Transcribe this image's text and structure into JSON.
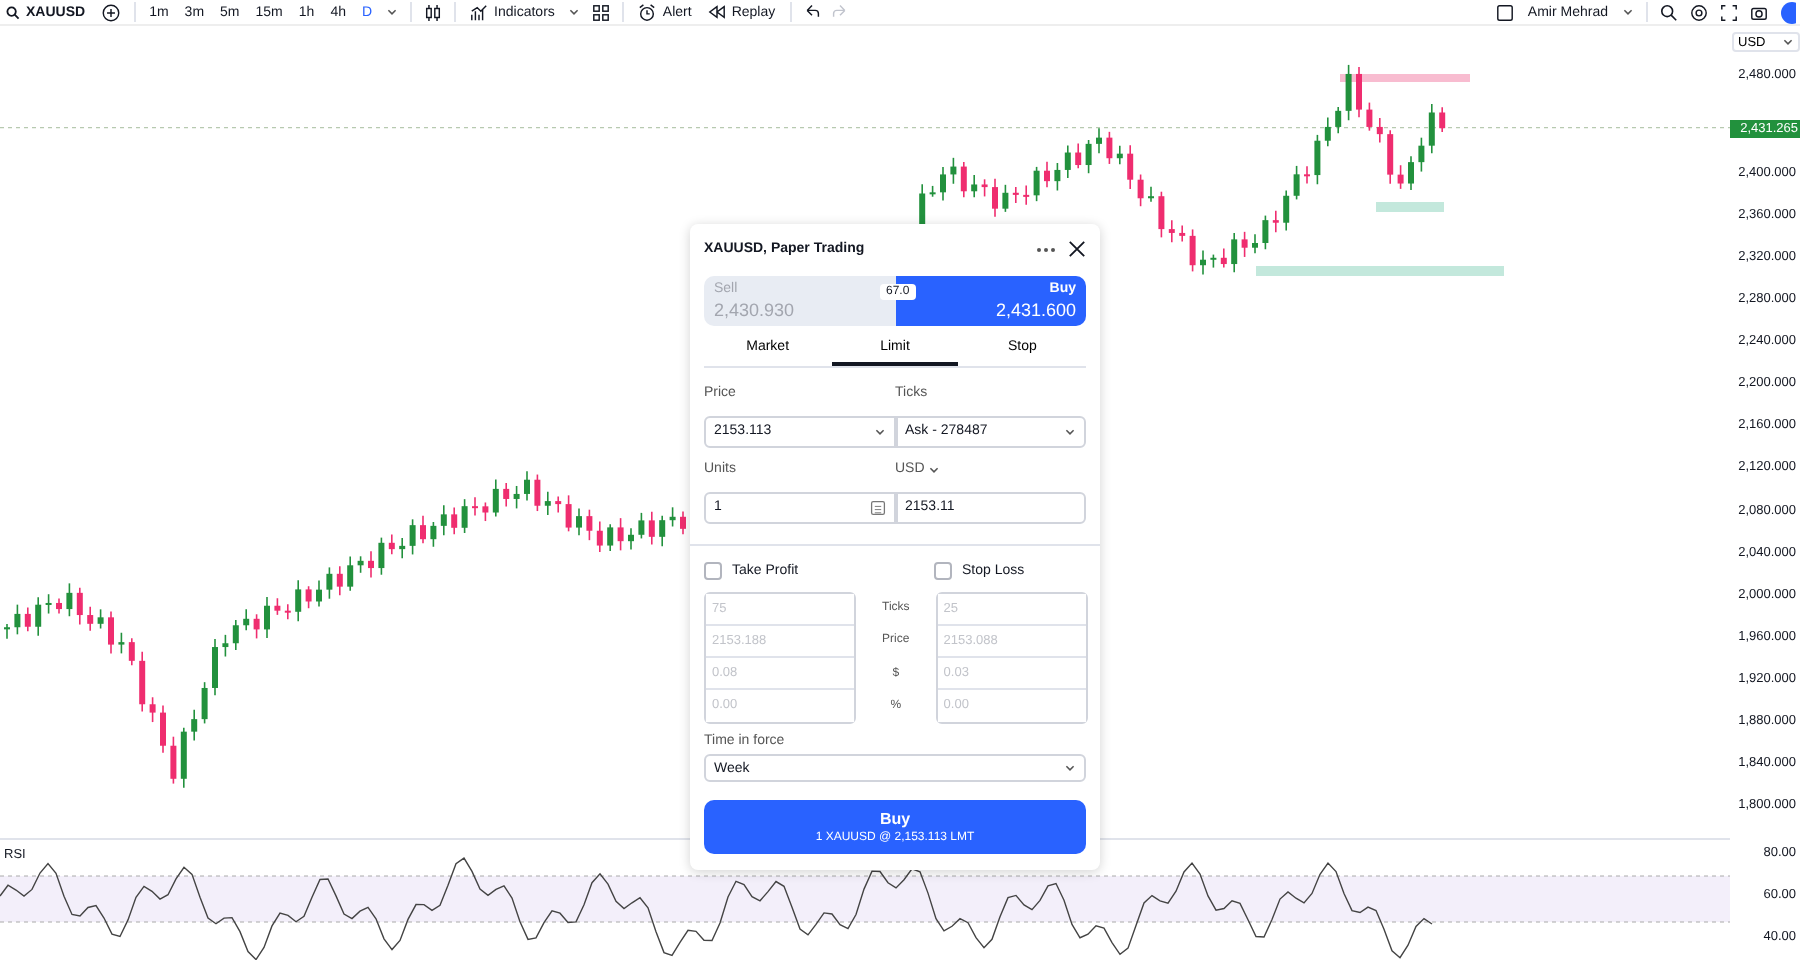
{
  "toolbar": {
    "symbol": "XAUUSD",
    "intervals": [
      {
        "label": "1m",
        "selected": false
      },
      {
        "label": "3m",
        "selected": false
      },
      {
        "label": "5m",
        "selected": false
      },
      {
        "label": "15m",
        "selected": false
      },
      {
        "label": "1h",
        "selected": false
      },
      {
        "label": "4h",
        "selected": false
      },
      {
        "label": "D",
        "selected": true
      }
    ],
    "indicators": "Indicators",
    "alert": "Alert",
    "replay": "Replay",
    "user": "Amir Mehrad"
  },
  "chart": {
    "currency": "USD",
    "price_ticks": [
      "2,480.000",
      "2,400.000",
      "2,360.000",
      "2,320.000",
      "2,280.000",
      "2,240.000",
      "2,200.000",
      "2,160.000",
      "2,120.000",
      "2,080.000",
      "2,040.000",
      "2,000.000",
      "1,960.000",
      "1,920.000",
      "1,880.000",
      "1,840.000",
      "1,800.000"
    ],
    "last_price": "2,431.265"
  },
  "rsi": {
    "label": "RSI",
    "ticks": [
      "80.00",
      "60.00",
      "40.00"
    ]
  },
  "order_panel": {
    "title": "XAUUSD, Paper Trading",
    "sides": [
      {
        "label": "Sell",
        "price": "2,430.930",
        "selected": false
      },
      {
        "label": "Buy",
        "price": "2,431.600",
        "selected": true
      }
    ],
    "spread": "67.0",
    "order_types": [
      {
        "label": "Market",
        "selected": false
      },
      {
        "label": "Limit",
        "selected": true
      },
      {
        "label": "Stop",
        "selected": false
      }
    ],
    "price": {
      "label": "Price",
      "value": "2153.113"
    },
    "ticks": {
      "label": "Ticks",
      "value": "Ask - 278487"
    },
    "units": {
      "label": "Units",
      "value": "1"
    },
    "amount": {
      "label": "USD",
      "value": "2153.11"
    },
    "row_labels": [
      "Ticks",
      "Price",
      "$",
      "%"
    ],
    "take_profit": {
      "label": "Take Profit",
      "checked": false,
      "values": [
        "75",
        "2153.188",
        "0.08",
        "0.00"
      ]
    },
    "stop_loss": {
      "label": "Stop Loss",
      "checked": false,
      "values": [
        "25",
        "2153.088",
        "0.03",
        "0.00"
      ]
    },
    "time_in_force": {
      "label": "Time in force",
      "value": "Week"
    },
    "submit": {
      "label": "Buy",
      "detail": "1 XAUUSD @ 2,153.113 LMT"
    }
  }
}
